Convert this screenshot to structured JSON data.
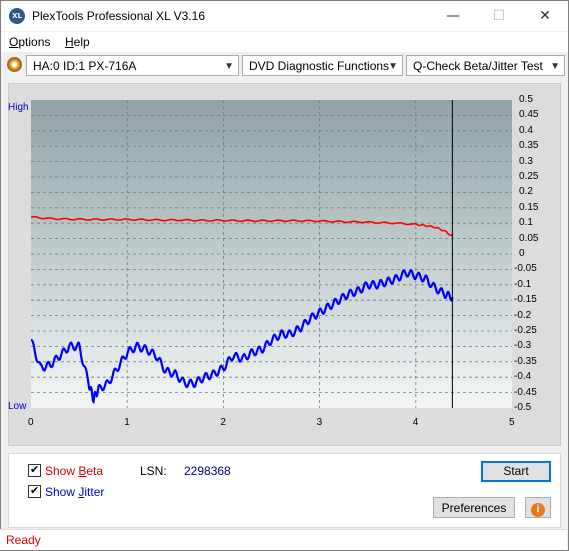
{
  "window": {
    "title": "PlexTools Professional XL V3.16",
    "icon_text": "XL"
  },
  "window_controls": {
    "minimize": "—",
    "maximize": "☐",
    "close": "✕"
  },
  "menu": [
    {
      "label": "Options",
      "accel": "O",
      "rest": "ptions"
    },
    {
      "label": "Help",
      "accel": "H",
      "rest": "elp"
    }
  ],
  "toolbar": {
    "drive": "HA:0 ID:1  PX-716A",
    "function": "DVD Diagnostic Functions",
    "test": "Q-Check Beta/Jitter Test"
  },
  "chart_data": {
    "type": "line",
    "y_label_high": "High",
    "y_label_low": "Low",
    "xlim": [
      0,
      5
    ],
    "ylim": [
      -0.5,
      0.5
    ],
    "x_ticks": [
      "0",
      "1",
      "2",
      "3",
      "4",
      "5"
    ],
    "y_ticks": [
      "0.5",
      "0.45",
      "0.4",
      "0.35",
      "0.3",
      "0.25",
      "0.2",
      "0.15",
      "0.1",
      "0.05",
      "0",
      "-0.05",
      "-0.1",
      "-0.15",
      "-0.2",
      "-0.25",
      "-0.3",
      "-0.35",
      "-0.4",
      "-0.45",
      "-0.5"
    ],
    "grid": true,
    "end_marker_x": 4.38,
    "series": [
      {
        "name": "Beta",
        "color": "#ff0000",
        "x": [
          0,
          0.2,
          0.4,
          0.6,
          0.8,
          1.0,
          1.2,
          1.4,
          1.6,
          1.8,
          2.0,
          2.2,
          2.4,
          2.6,
          2.8,
          3.0,
          3.2,
          3.4,
          3.6,
          3.8,
          4.0,
          4.1,
          4.2,
          4.3,
          4.38
        ],
        "y": [
          0.12,
          0.115,
          0.113,
          0.112,
          0.112,
          0.112,
          0.111,
          0.11,
          0.11,
          0.109,
          0.109,
          0.108,
          0.108,
          0.108,
          0.108,
          0.107,
          0.105,
          0.104,
          0.102,
          0.1,
          0.096,
          0.092,
          0.087,
          0.075,
          0.057
        ]
      },
      {
        "name": "Jitter",
        "color": "#0000ff",
        "x": [
          0,
          0.1,
          0.2,
          0.3,
          0.4,
          0.5,
          0.6,
          0.65,
          0.7,
          0.8,
          0.9,
          1.0,
          1.1,
          1.2,
          1.3,
          1.4,
          1.5,
          1.6,
          1.7,
          1.8,
          1.9,
          2.0,
          2.1,
          2.2,
          2.3,
          2.4,
          2.5,
          2.6,
          2.7,
          2.8,
          2.9,
          3.0,
          3.1,
          3.2,
          3.3,
          3.4,
          3.5,
          3.6,
          3.7,
          3.8,
          3.9,
          4.0,
          4.1,
          4.2,
          4.3,
          4.38
        ],
        "y": [
          -0.28,
          -0.37,
          -0.36,
          -0.33,
          -0.3,
          -0.3,
          -0.42,
          -0.47,
          -0.44,
          -0.42,
          -0.37,
          -0.32,
          -0.3,
          -0.31,
          -0.33,
          -0.38,
          -0.39,
          -0.42,
          -0.42,
          -0.4,
          -0.39,
          -0.37,
          -0.33,
          -0.34,
          -0.32,
          -0.31,
          -0.28,
          -0.26,
          -0.26,
          -0.24,
          -0.21,
          -0.19,
          -0.17,
          -0.15,
          -0.13,
          -0.12,
          -0.1,
          -0.1,
          -0.09,
          -0.08,
          -0.06,
          -0.07,
          -0.08,
          -0.11,
          -0.13,
          -0.14
        ]
      }
    ]
  },
  "controls": {
    "show_beta": {
      "label": "Show Beta",
      "accel": "B",
      "checked": true
    },
    "show_jitter": {
      "label": "Show Jitter",
      "accel": "J",
      "checked": true
    },
    "lsn_label": "LSN:",
    "lsn_value": "2298368",
    "start": "Start",
    "preferences": "Preferences",
    "info_icon": "i"
  },
  "status": "Ready"
}
